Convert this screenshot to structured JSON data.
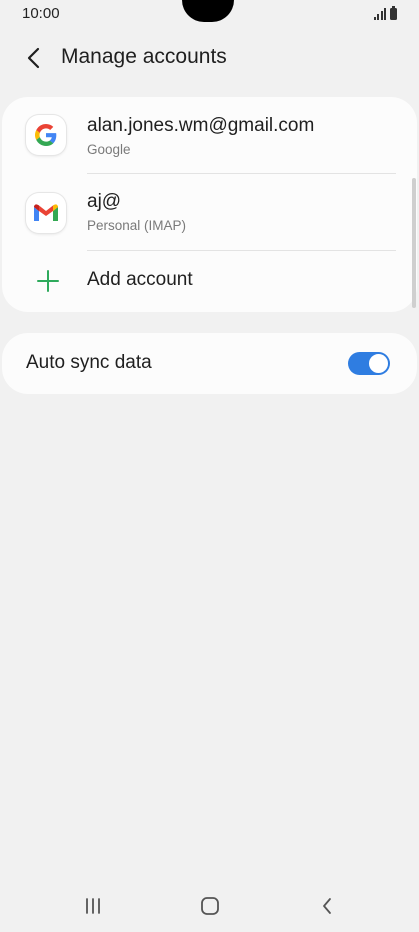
{
  "status_bar": {
    "time": "10:00"
  },
  "header": {
    "title": "Manage accounts"
  },
  "accounts": [
    {
      "primary": "alan.jones.wm@gmail.com",
      "secondary": "Google",
      "icon": "google-icon"
    },
    {
      "primary": "aj@",
      "secondary": "Personal (IMAP)",
      "icon": "gmail-icon"
    }
  ],
  "add_account": {
    "label": "Add account",
    "icon": "plus-icon"
  },
  "sync": {
    "label": "Auto sync data",
    "enabled": true
  },
  "colors": {
    "background": "#f1f1f1",
    "card": "#fcfcfc",
    "toggle_on": "#2f7de1",
    "add_icon": "#2eaa5c"
  },
  "nav_bar": {
    "buttons": [
      "recents-icon",
      "home-icon",
      "back-icon"
    ]
  }
}
